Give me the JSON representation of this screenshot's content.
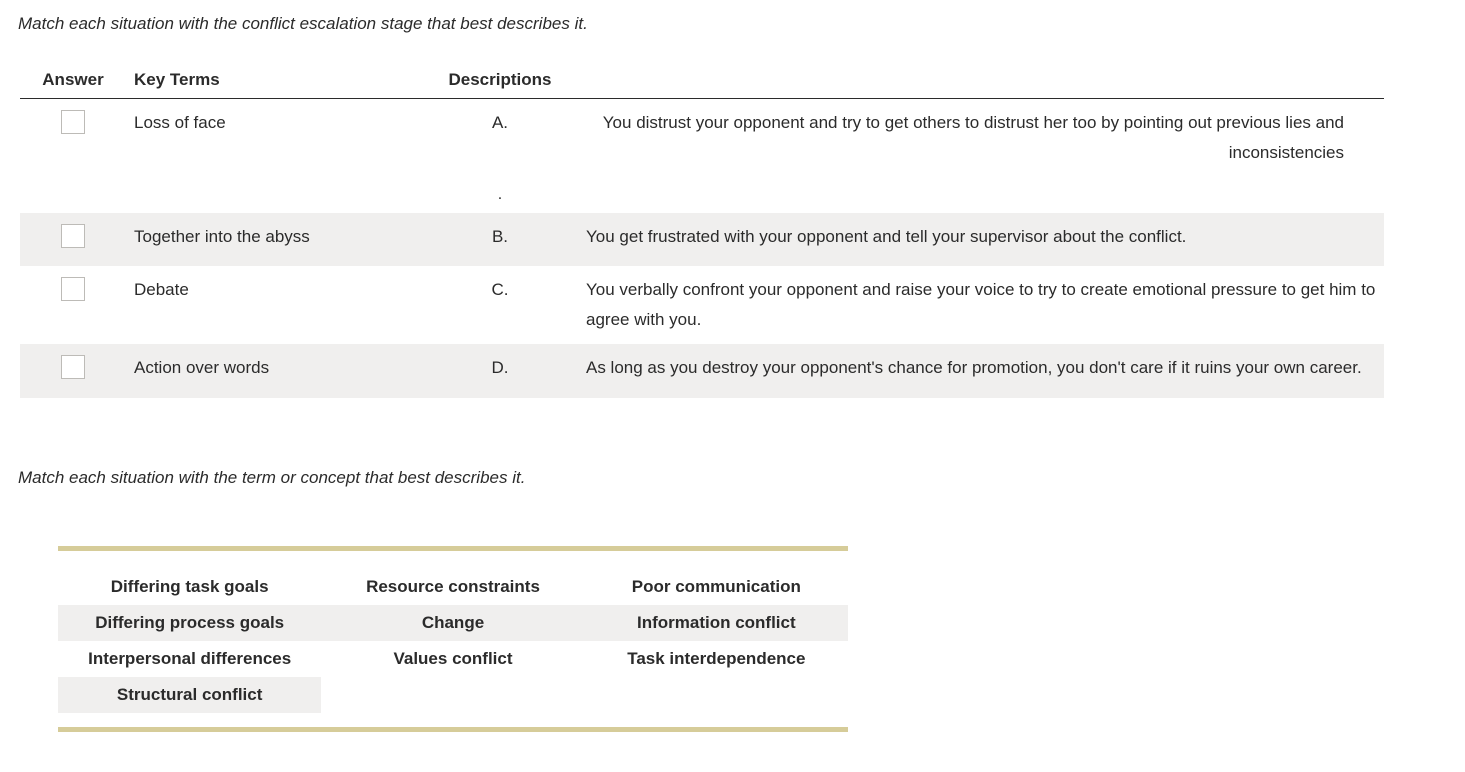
{
  "question1": {
    "prompt": "Match each situation with the conflict escalation stage that best describes it.",
    "headers": {
      "answer": "Answer",
      "key_terms": "Key Terms",
      "descriptions": "Descriptions"
    },
    "rows": [
      {
        "term": "Loss of face",
        "letter": "A.",
        "description": "You distrust your opponent and try to get others to distrust her too by pointing out previous lies and inconsistencies"
      },
      {
        "term": "Together into the abyss",
        "letter": "B.",
        "description": "You get frustrated with your opponent and tell your supervisor about the conflict."
      },
      {
        "term": "Debate",
        "letter": "C.",
        "description": "You verbally confront your opponent and raise your voice to try to create emotional pressure to get him to agree with you."
      },
      {
        "term": "Action over words",
        "letter": "D.",
        "description": "As long as you destroy your opponent's chance for promotion, you don't care if it ruins your own career."
      }
    ],
    "dot": "."
  },
  "question2": {
    "prompt": "Match each situation with the term or concept that best describes it.",
    "concepts": [
      [
        "Differing task goals",
        "Resource constraints",
        "Poor communication"
      ],
      [
        "Differing process goals",
        "Change",
        "Information conflict"
      ],
      [
        "Interpersonal differences",
        "Values conflict",
        "Task interdependence"
      ],
      [
        "Structural conflict",
        "",
        ""
      ]
    ]
  }
}
